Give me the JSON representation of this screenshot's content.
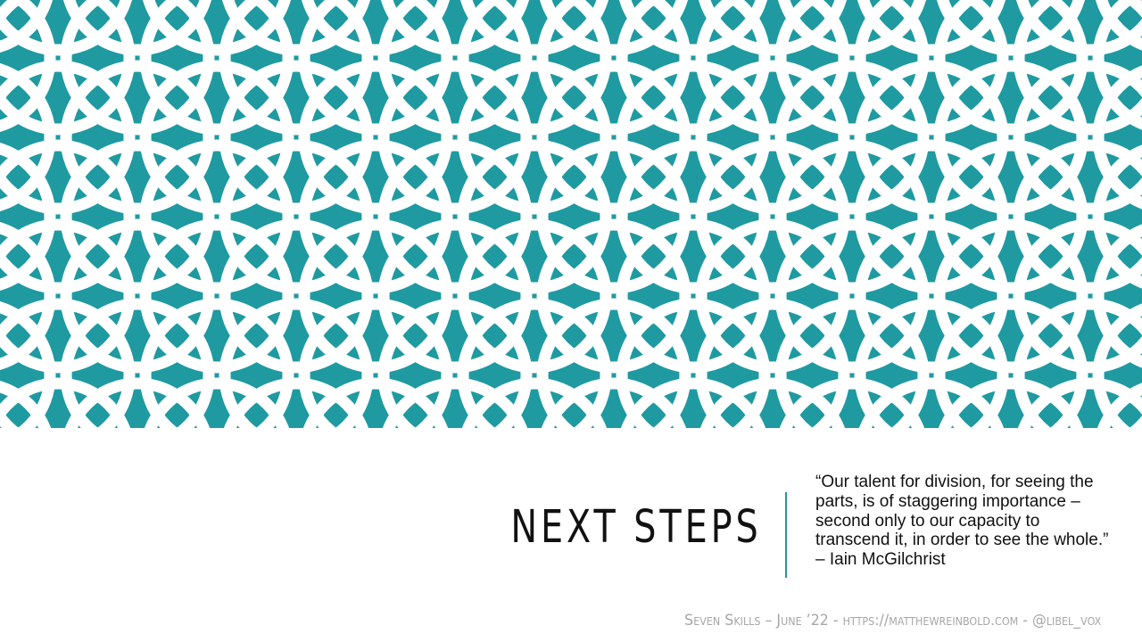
{
  "slide": {
    "title": "NEXT STEPS",
    "quote": "“Our talent for division, for seeing the parts, is of staggering importance – second only to our capacity to transcend it, in order to see the whole.” – Iain McGilchrist",
    "footer": "Seven Skills – June ’22 - https://matthewreinbold.com - @libel_vox"
  },
  "colors": {
    "pattern_background": "#1f9aa1",
    "pattern_ring": "#ffffff",
    "divider": "#2196a0",
    "title_text": "#111111",
    "footer_text": "#a6a6a6"
  }
}
